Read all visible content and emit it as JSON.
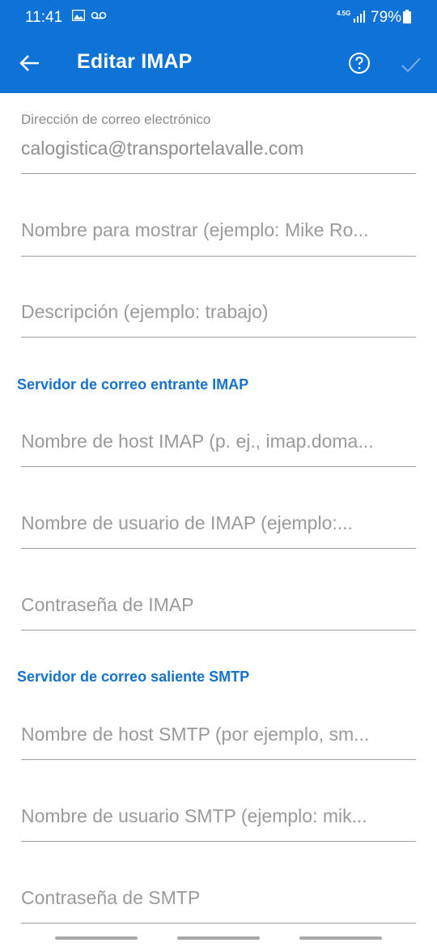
{
  "status_bar": {
    "time": "11:41",
    "network": "4.5G",
    "battery": "79%"
  },
  "app_bar": {
    "title": "Editar IMAP",
    "back_icon": "arrow-left-icon",
    "help_icon": "help-circle-icon",
    "confirm_icon": "check-icon"
  },
  "form": {
    "email": {
      "label": "Dirección de correo electrónico",
      "value": "calogistica@transportelavalle.com"
    },
    "display_name_placeholder": "Nombre para mostrar (ejemplo: Mike Ro...",
    "description_placeholder": "Descripción (ejemplo: trabajo)",
    "imap_section": "Servidor de correo entrante IMAP",
    "imap_host_placeholder": "Nombre de host IMAP (p. ej., imap.doma...",
    "imap_user_placeholder": "Nombre de usuario de IMAP (ejemplo:...",
    "imap_password_placeholder": "Contraseña de IMAP",
    "smtp_section": "Servidor de correo saliente SMTP",
    "smtp_host_placeholder": "Nombre de host SMTP (por ejemplo, sm...",
    "smtp_user_placeholder": "Nombre de usuario SMTP (ejemplo: mik...",
    "smtp_password_placeholder": "Contraseña de SMTP"
  },
  "colors": {
    "app_bar": "#0F72D6",
    "section_header": "#1672CC",
    "text_muted": "#8e8e8e",
    "divider": "#9e9e9e"
  }
}
